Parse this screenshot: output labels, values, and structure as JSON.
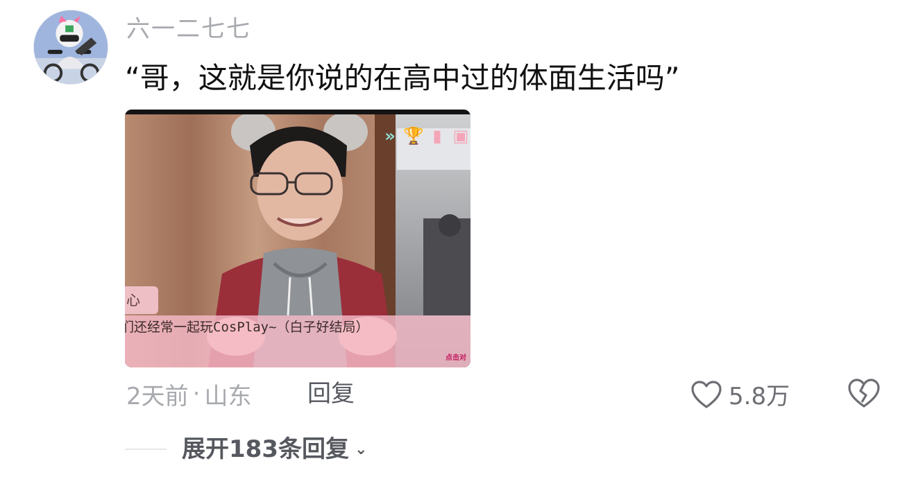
{
  "comment": {
    "username": "六一二七七",
    "text": "“哥，这就是你说的在高中过的体面生活吗”",
    "time": "2天前",
    "separator": "·",
    "location": "山东",
    "reply_label": "回复",
    "like_count": "5.8万",
    "expand_label": "展开183条回复",
    "icons": {
      "like": "heart-outline-icon",
      "dislike": "broken-heart-icon",
      "expand": "chevron-down-icon"
    }
  },
  "media": {
    "name_box_text": "心",
    "dialog_text": "们还经常一起玩CosPlay~（白子好结局）",
    "click_hint": "点击对",
    "icons": [
      "fast-forward-icon",
      "trophy-icon",
      "notebook-icon",
      "save-icon"
    ]
  },
  "colors": {
    "username": "#a7a9ae",
    "text": "#111111",
    "meta": "#a7a9ae",
    "action": "#55585e",
    "dialog_bg": "#f5bac8"
  }
}
